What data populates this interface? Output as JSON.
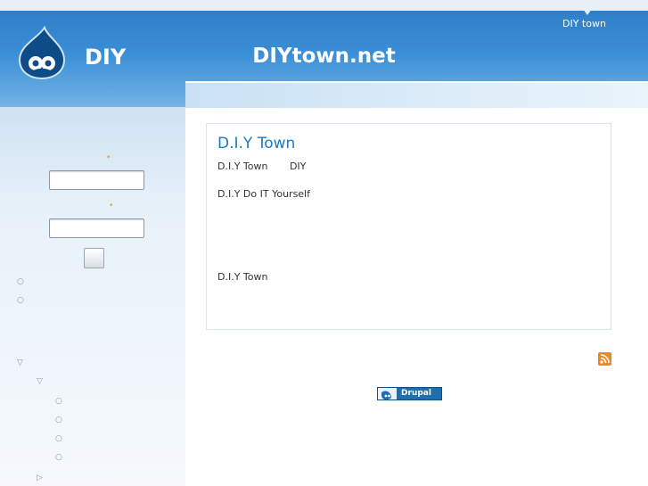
{
  "header": {
    "site_name": "DIY",
    "site_slogan": "DIYtown.net",
    "primary_links": [
      {
        "label": "DIY town"
      }
    ]
  },
  "sidebar": {
    "login": {
      "required_mark": "•"
    },
    "tree": {
      "bullet": "○",
      "expanded": "▽",
      "collapsed": "▷"
    }
  },
  "node": {
    "title": "D.I.Y Town",
    "line1": "D.I.Y Town       DIY",
    "line2": "D.I.Y Do IT Yourself",
    "line3": "D.I.Y Town"
  },
  "footer": {
    "badge_label": "Drupal"
  },
  "colors": {
    "header_blue": "#3b8fd6",
    "link_blue": "#1f79bd",
    "rss_orange": "#f2891e",
    "required_star": "#f0a030"
  }
}
